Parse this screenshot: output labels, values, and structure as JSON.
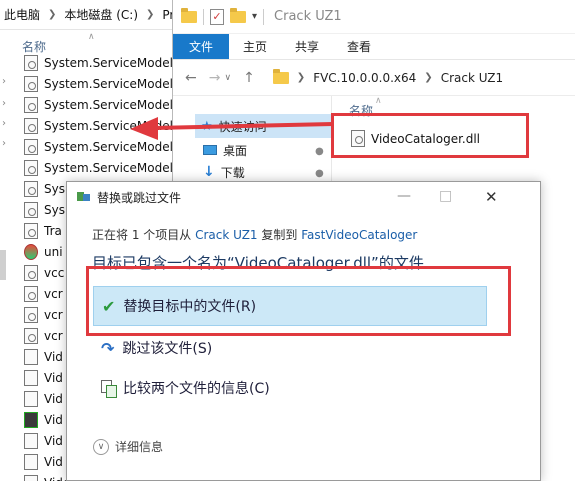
{
  "background": {
    "breadcrumb": [
      "此电脑",
      "本地磁盘 (C:)",
      "Pro"
    ],
    "column_header": "名称",
    "files": [
      {
        "name": "System.ServiceModel",
        "icon": "dll-file-icon"
      },
      {
        "name": "System.ServiceModel",
        "icon": "dll-file-icon"
      },
      {
        "name": "System.ServiceModel",
        "icon": "dll-file-icon"
      },
      {
        "name": "System.ServiceModel",
        "icon": "dll-file-icon"
      },
      {
        "name": "System.ServiceModel",
        "icon": "dll-file-icon"
      },
      {
        "name": "System.ServiceModel",
        "icon": "dll-file-icon"
      },
      {
        "name": "Sys",
        "icon": "dll-file-icon"
      },
      {
        "name": "Sys",
        "icon": "dll-file-icon"
      },
      {
        "name": "Tra",
        "icon": "dll-file-icon"
      },
      {
        "name": "uni",
        "icon": "color-app-icon"
      },
      {
        "name": "vcc",
        "icon": "dll-file-icon"
      },
      {
        "name": "vcr",
        "icon": "dll-file-icon"
      },
      {
        "name": "vcr",
        "icon": "dll-file-icon"
      },
      {
        "name": "vcr",
        "icon": "dll-file-icon"
      },
      {
        "name": "Vid",
        "icon": "file-icon"
      },
      {
        "name": "Vid",
        "icon": "file-icon"
      },
      {
        "name": "Vid",
        "icon": "file-icon"
      },
      {
        "name": "Vid",
        "icon": "film-icon"
      },
      {
        "name": "Vid",
        "icon": "file-icon"
      },
      {
        "name": "Vid",
        "icon": "file-icon"
      },
      {
        "name": "VideoCatalogerService",
        "icon": "file-icon"
      }
    ]
  },
  "explorer": {
    "title": "Crack UZ1",
    "ribbon_tabs": [
      "文件",
      "主页",
      "共享",
      "查看"
    ],
    "address_path": [
      "FVC.10.0.0.0.x64",
      "Crack UZ1"
    ],
    "nav_pane": {
      "quick_access": "快速访问",
      "desktop": "桌面",
      "downloads": "下载"
    },
    "column_header": "名称",
    "file": "VideoCataloger.dll"
  },
  "dialog": {
    "title": "替换或跳过文件",
    "info": {
      "prefix": "正在将 1 个项目从",
      "source": "Crack UZ1",
      "middle": "复制到",
      "target": "FastVideoCataloger"
    },
    "message": "目标已包含一个名为“VideoCataloger.dll”的文件",
    "options": {
      "replace": "替换目标中的文件(R)",
      "skip": "跳过该文件(S)",
      "compare": "比较两个文件的信息(C)"
    },
    "details": "详细信息"
  },
  "colors": {
    "accent_blue": "#1979ca",
    "highlight_red": "#e0393e",
    "selection_blue": "#cce8f7",
    "link_blue": "#1a5ea8"
  }
}
